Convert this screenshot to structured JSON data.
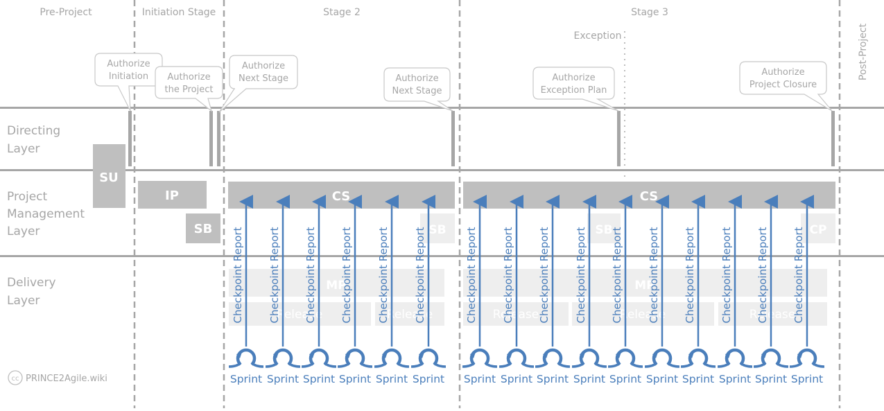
{
  "phases": {
    "pre_project": "Pre-Project",
    "initiation": "Initiation Stage",
    "stage2": "Stage 2",
    "stage3": "Stage 3",
    "exception": "Exception",
    "post_project": "Post-Project"
  },
  "layers": {
    "directing": [
      "Directing",
      "Layer"
    ],
    "management": [
      "Project",
      "Management",
      "Layer"
    ],
    "delivery": [
      "Delivery",
      "Layer"
    ]
  },
  "callouts": [
    [
      "Authorize",
      "Initiation"
    ],
    [
      "Authorize",
      "the Project"
    ],
    [
      "Authorize",
      "Next Stage"
    ],
    [
      "Authorize",
      "Next Stage"
    ],
    [
      "Authorize",
      "Exception Plan"
    ],
    [
      "Authorize",
      "Project Closure"
    ]
  ],
  "boxes": {
    "su": "SU",
    "ip": "IP",
    "sb": "SB",
    "cs1": "CS",
    "cs2": "CS",
    "sb_faded1": "SB",
    "sb_faded2": "SB",
    "cp_faded": "CP",
    "mp1": "MP",
    "mp2": "MP",
    "releases": [
      "Release",
      "Release",
      "Release",
      "Release",
      "Release"
    ]
  },
  "checkpoint_label": "Checkpoint Report",
  "sprint_label": "Sprint",
  "sprint_count_stage2": 6,
  "sprint_count_stage3": 10,
  "credit": {
    "icon": "cc-icon",
    "text": "PRINCE2Agile.wiki"
  },
  "colors": {
    "accent": "#4a7ebb",
    "gray": "#bfbfbf",
    "line": "#a6a6a6"
  }
}
